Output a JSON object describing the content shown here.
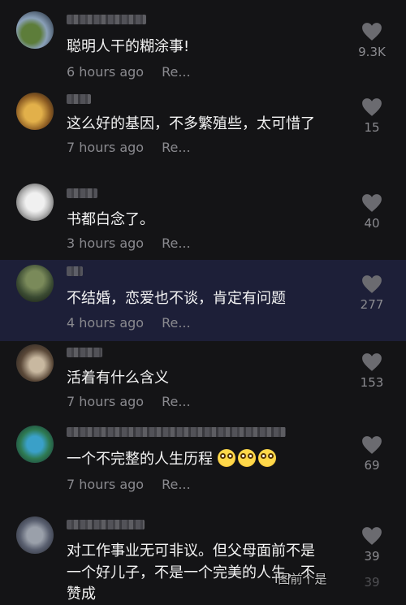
{
  "comments": [
    {
      "text": "聪明人干的糊涂事!",
      "time": "6 hours ago",
      "reply": "Re...",
      "likes": "9.3K"
    },
    {
      "text": "这么好的基因，不多繁殖些，太可惜了",
      "time": "7 hours ago",
      "reply": "Re...",
      "likes": "15"
    },
    {
      "text": "书都白念了。",
      "time": "3 hours ago",
      "reply": "Re...",
      "likes": "40"
    },
    {
      "text": "不结婚，恋爱也不谈，肯定有问题",
      "time": "4 hours ago",
      "reply": "Re...",
      "likes": "277"
    },
    {
      "text": "活着有什么含义",
      "time": "7 hours ago",
      "reply": "Re...",
      "likes": "153"
    },
    {
      "text": "一个不完整的人生历程",
      "time": "7 hours ago",
      "reply": "Re...",
      "likes": "69"
    },
    {
      "text_line1": "对工作事业无可非议。但父母面前不是",
      "text_line2": "一个好儿子，不是一个完美的人生，不",
      "text_line3": "赞成",
      "likes": "39",
      "likes_faded": "39"
    }
  ],
  "watermark": "I图前个是",
  "colors": {
    "background": "#141416",
    "highlight": "#1d1f38",
    "text": "#f4f4f4",
    "meta": "#8a8a8f",
    "heart": "#6b6b70"
  },
  "icons": {
    "like": "heart-icon",
    "emoji": "dizzy-face-emoji"
  }
}
